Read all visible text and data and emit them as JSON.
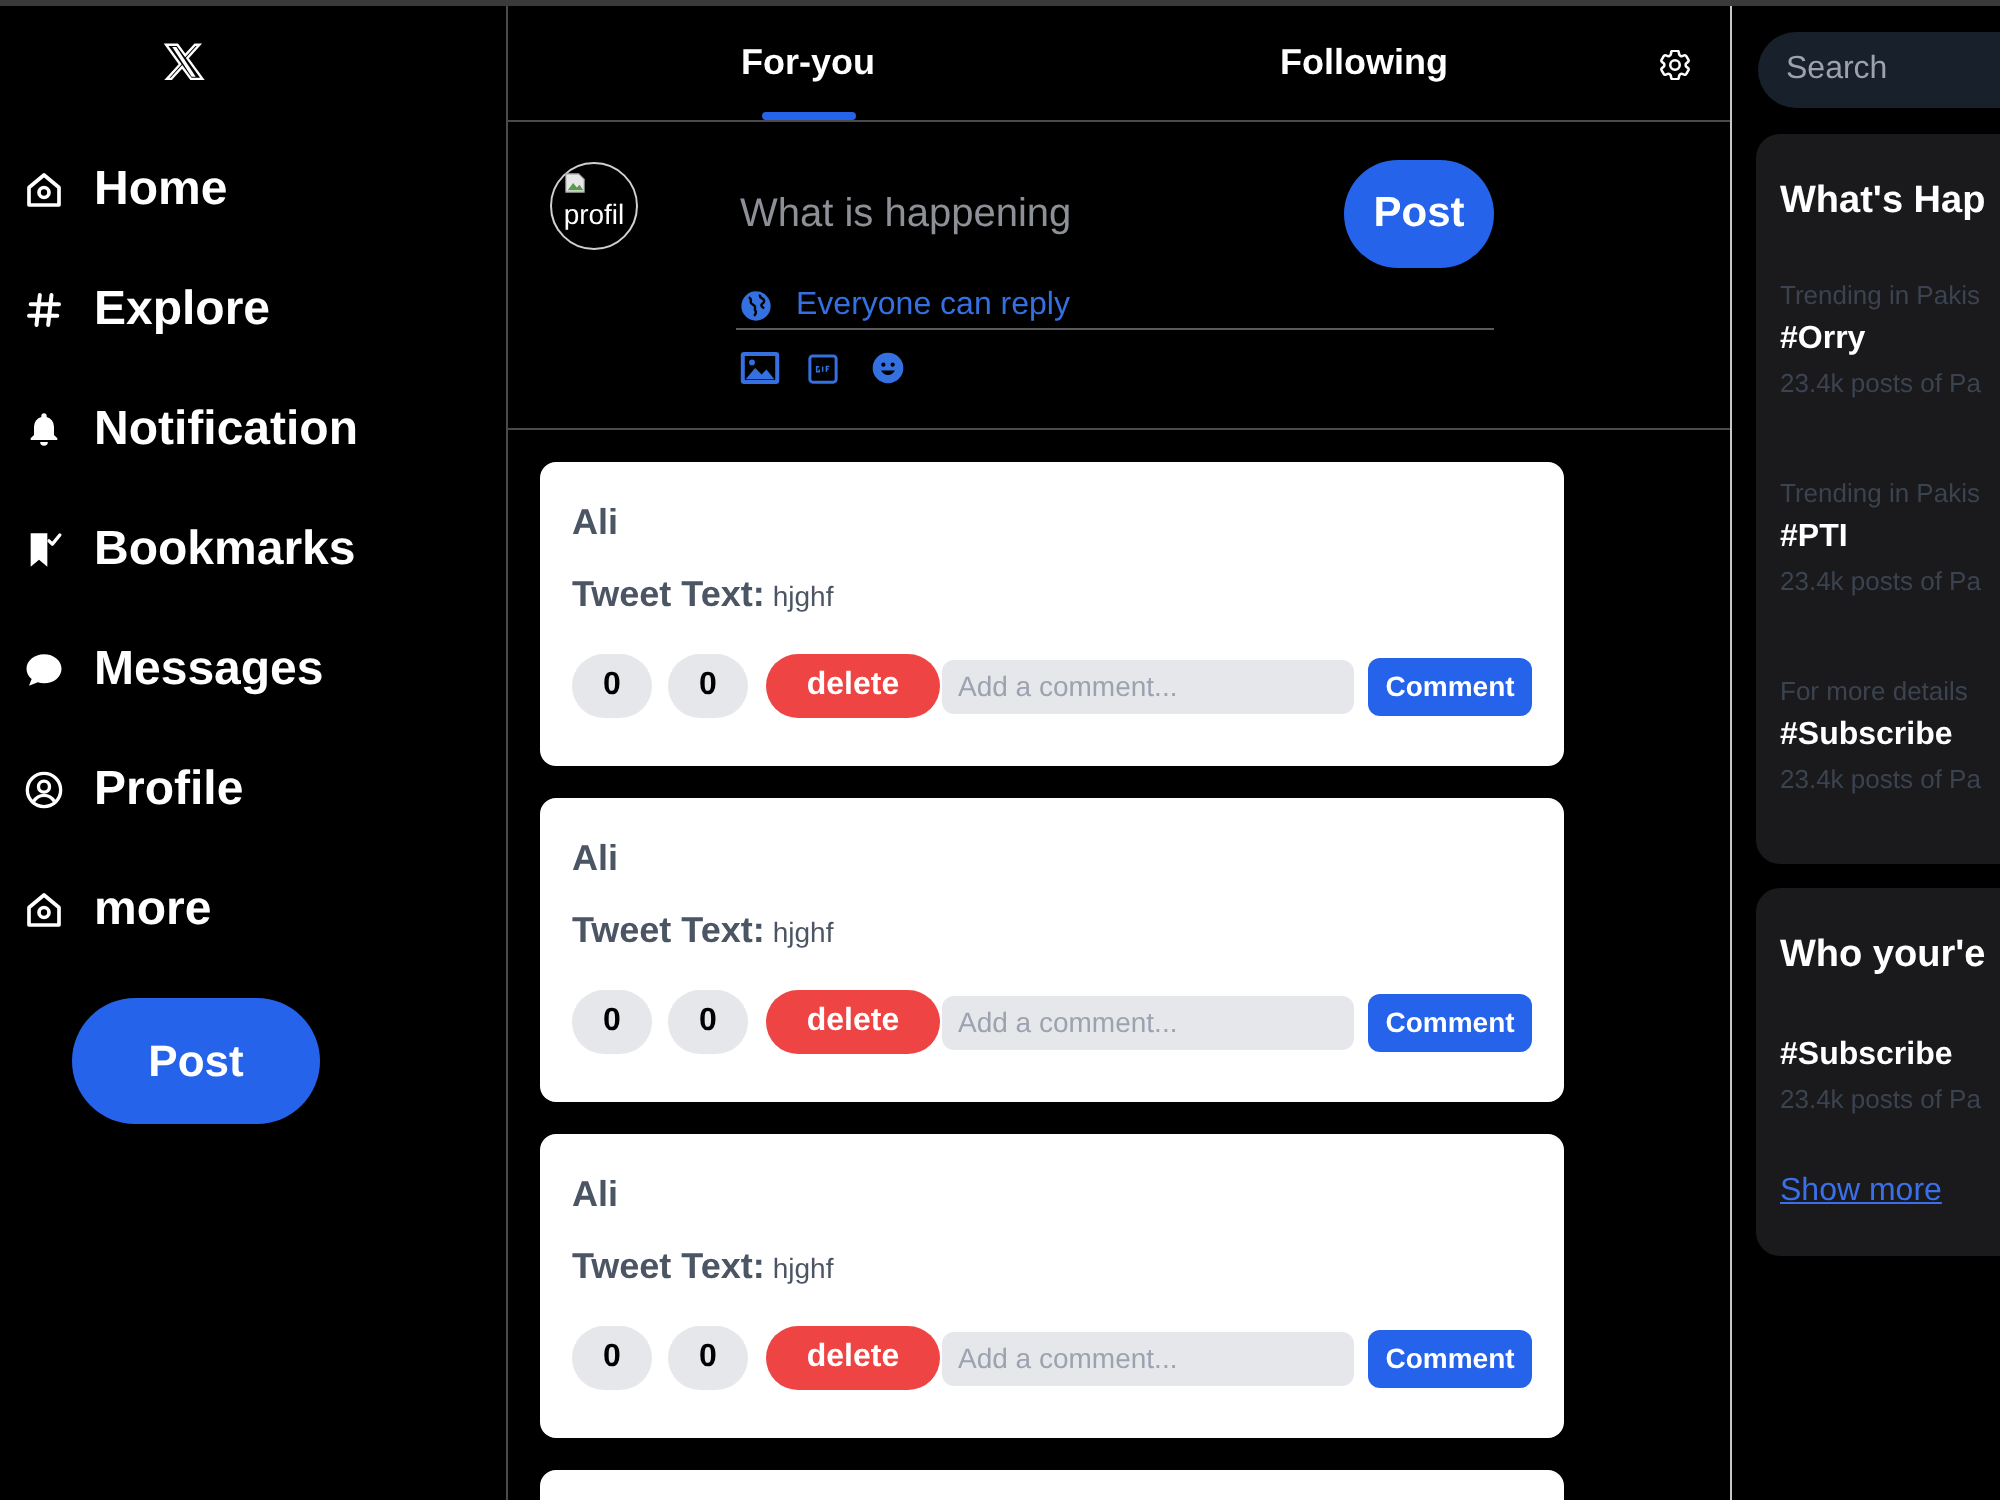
{
  "sidebar": {
    "nav": [
      {
        "label": "Home"
      },
      {
        "label": "Explore"
      },
      {
        "label": "Notification"
      },
      {
        "label": "Bookmarks"
      },
      {
        "label": "Messages"
      },
      {
        "label": "Profile"
      },
      {
        "label": "more"
      }
    ],
    "post_button": "Post"
  },
  "tabs": [
    {
      "label": "For-you",
      "selected": true
    },
    {
      "label": "Following",
      "selected": false
    }
  ],
  "compose": {
    "avatar_text": "profil",
    "placeholder": "What is happening",
    "post_button": "Post",
    "reply_setting": "Everyone can reply"
  },
  "tweets": [
    {
      "author": "Ali",
      "text_label": "Tweet Text:",
      "text": "hjghf",
      "counts": [
        "0",
        "0"
      ],
      "delete_button": "delete",
      "comment_placeholder": "Add a comment...",
      "comment_button": "Comment"
    },
    {
      "author": "Ali",
      "text_label": "Tweet Text:",
      "text": "hjghf",
      "counts": [
        "0",
        "0"
      ],
      "delete_button": "delete",
      "comment_placeholder": "Add a comment...",
      "comment_button": "Comment"
    },
    {
      "author": "Ali",
      "text_label": "Tweet Text:",
      "text": "hjghf",
      "counts": [
        "0",
        "0"
      ],
      "delete_button": "delete",
      "comment_placeholder": "Add a comment...",
      "comment_button": "Comment"
    }
  ],
  "search": {
    "placeholder": "Search"
  },
  "trends": {
    "title": "What's Hap",
    "items": [
      {
        "context": "Trending in Pakis",
        "tag": "#Orry",
        "posts": "23.4k posts of Pa"
      },
      {
        "context": "Trending in Pakis",
        "tag": "#PTI",
        "posts": "23.4k posts of Pa"
      },
      {
        "context": "For more details",
        "tag": "#Subscribe",
        "posts": "23.4k posts of Pa"
      }
    ]
  },
  "who_section": {
    "title": "Who your'e",
    "items": [
      {
        "tag": "#Subscribe",
        "posts": "23.4k posts of Pa"
      }
    ],
    "show_more": "Show more"
  }
}
